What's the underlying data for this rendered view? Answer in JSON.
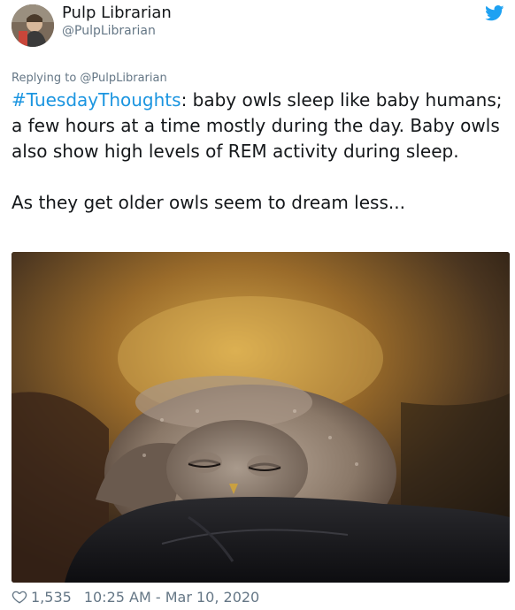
{
  "author": {
    "display_name": "Pulp Librarian",
    "handle": "@PulpLibrarian"
  },
  "icons": {
    "bird": "twitter-bird-icon",
    "heart": "heart-icon"
  },
  "colors": {
    "link": "#1b95e0",
    "muted": "#657786",
    "text": "#14171a"
  },
  "tweet": {
    "replying_to": "Replying to @PulpLibrarian",
    "hashtag": "#TuesdayThoughts",
    "body": ": baby owls sleep like baby humans; a few hours at a time mostly during the day. Baby owls also show high levels of REM activity during sleep.",
    "second_paragraph": "As they get older owls seem to dream less..."
  },
  "footer": {
    "likes": "1,535",
    "timestamp": "10:25 AM - Mar 10, 2020"
  }
}
